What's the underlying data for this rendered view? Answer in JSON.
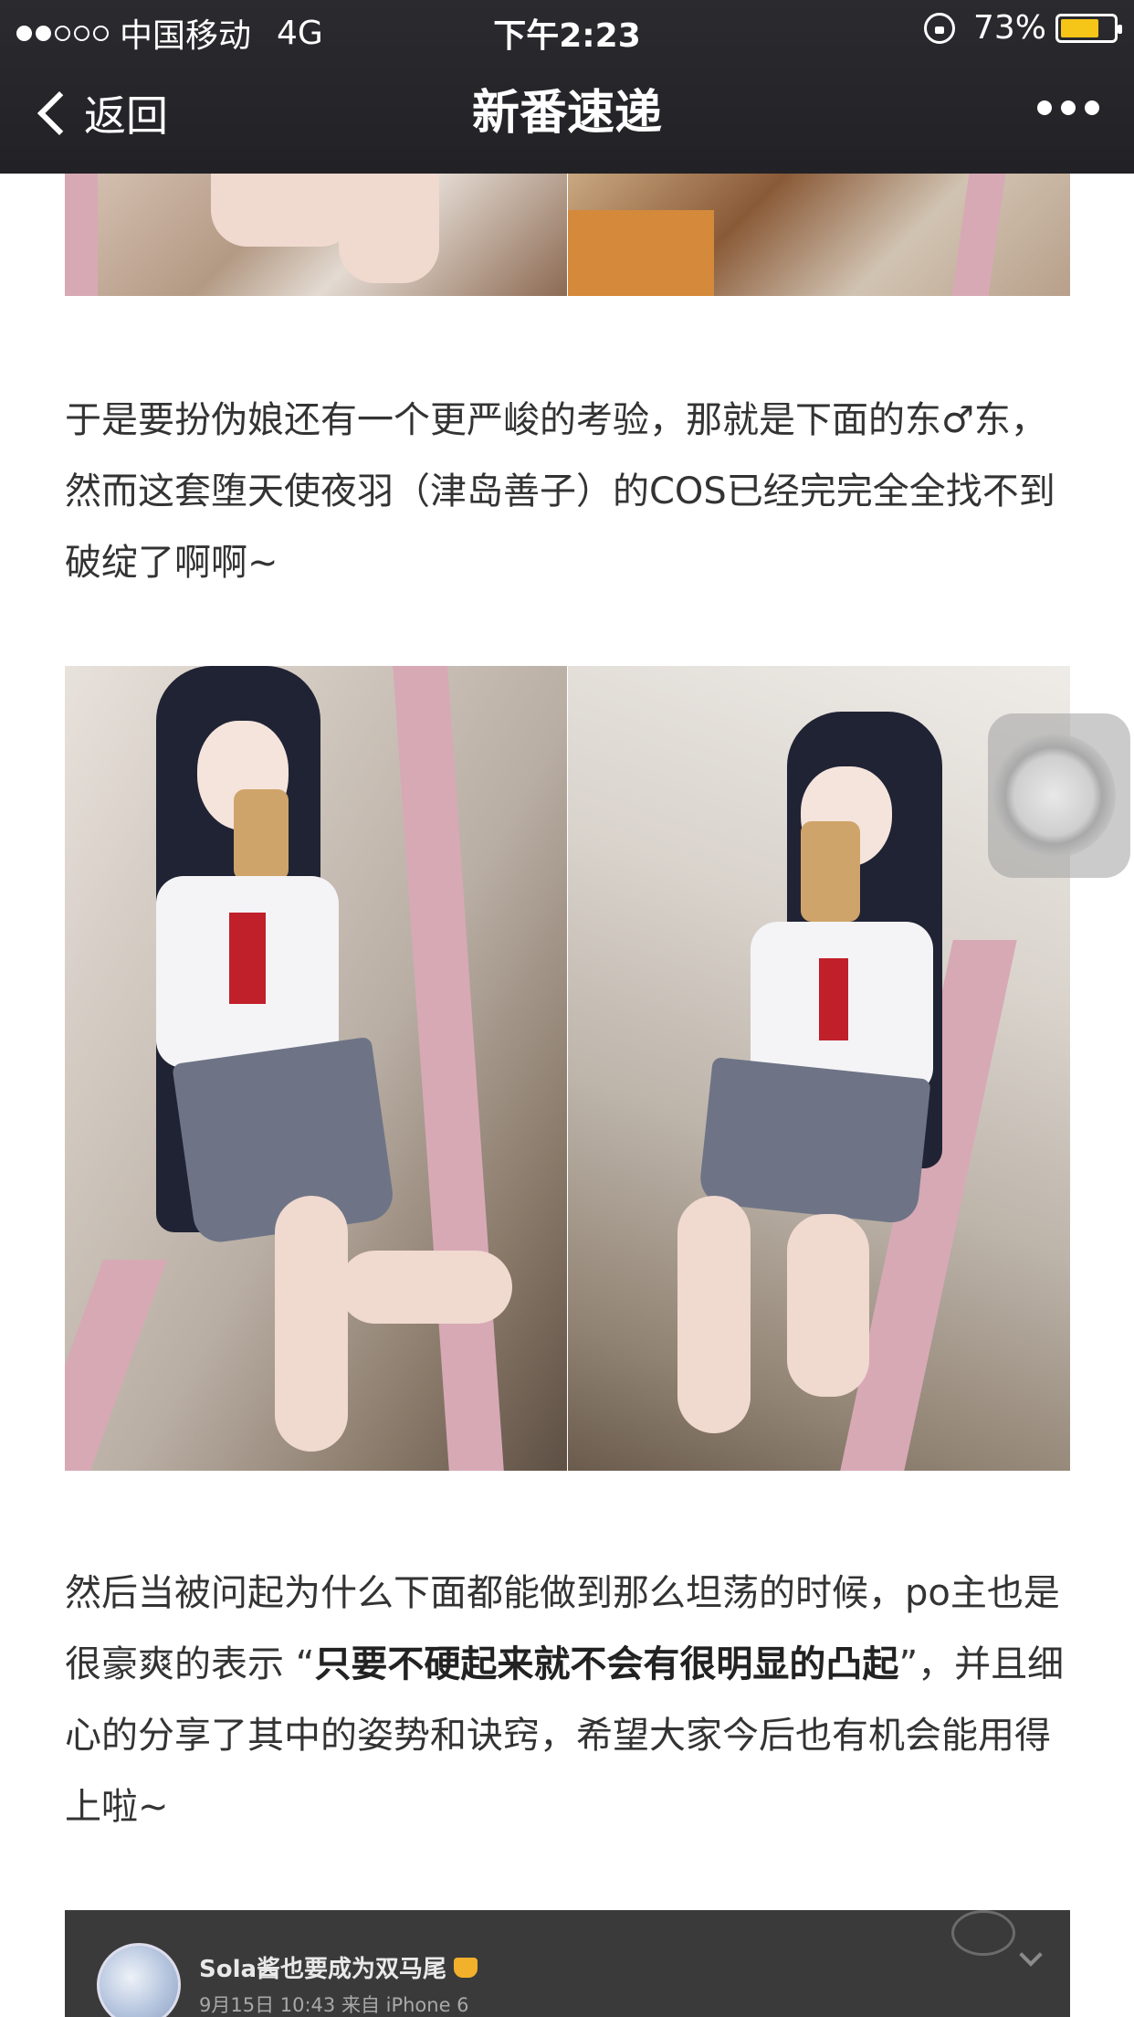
{
  "status_bar": {
    "carrier": "中国移动",
    "network": "4G",
    "time": "下午2:23",
    "battery": "73%",
    "battery_level": 0.73,
    "signal_bars_filled": 2,
    "signal_bars_total": 5,
    "battery_color": "#f5c518"
  },
  "nav": {
    "back_label": "返回",
    "title": "新番速递",
    "more_icon": "more-dots-icon"
  },
  "article": {
    "paragraph1": "于是要扮伪娘还有一个更严峻的考验，那就是下面的东♂东，然而这套堕天使夜羽（津岛善子）的COS已经完完全全找不到破绽了啊啊~",
    "paragraph2_before": "然后当被问起为什么下面都能做到那么坦荡的时候，po主也是很豪爽的表示 “",
    "paragraph2_bold": "只要不硬起来就不会有很明显的凸起",
    "paragraph2_after": "”，并且细心的分享了其中的姿势和诀窍，希望大家今后也有机会能用得上啦~"
  },
  "card": {
    "username": "Sola酱也要成为双马尾",
    "meta": "9月15日 10:43 来自 iPhone 6",
    "vip_icon": "vip-badge-icon"
  }
}
